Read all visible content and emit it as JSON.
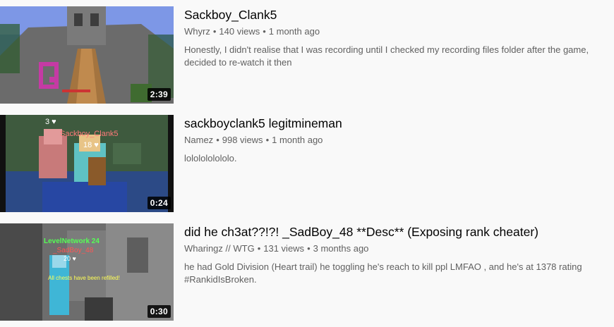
{
  "videos": [
    {
      "title": "Sackboy_Clank5",
      "channel": "Whyrz",
      "views": "140 views",
      "age": "1 month ago",
      "description": "Honestly, I didn't realise that I was recording until I checked my recording files folder after the game, decided to re-watch it then",
      "duration": "2:39"
    },
    {
      "title": "sackboyclank5 legitmineman",
      "channel": "Namez",
      "views": "998 views",
      "age": "1 month ago",
      "description": "lololololololo.",
      "duration": "0:24",
      "thumb_text": {
        "health_top": "3 ♥",
        "player_name": "Sackboy_Clank5",
        "health_mid": "18 ♥"
      }
    },
    {
      "title": "did he ch3at??!?! _SadBoy_48 **Desc** (Exposing rank cheater)",
      "channel": "Wharingz // WTG",
      "views": "131 views",
      "age": "3 months ago",
      "description": "he had Gold Division (Heart trail) he toggling he's reach to kill ppl LMFAO , and he's at 1378 rating #RankidIsBroken.",
      "duration": "0:30",
      "thumb_text": {
        "network": "LevelNetwork 24",
        "player_name": "_SadBoy_48",
        "health": "20 ♥",
        "chat": "All chests have been refilled!"
      }
    }
  ],
  "separator": "•"
}
